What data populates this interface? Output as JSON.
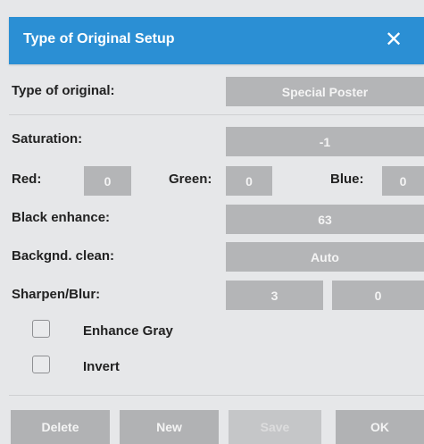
{
  "dialog": {
    "title": "Type of Original Setup",
    "close_glyph": "✕",
    "close_icon": "close-icon"
  },
  "type_of_original": {
    "label": "Type of original:",
    "value": "Special Poster"
  },
  "saturation": {
    "label": "Saturation:",
    "value": "-1"
  },
  "rgb": {
    "red_label": "Red:",
    "red_value": "0",
    "green_label": "Green:",
    "green_value": "0",
    "blue_label": "Blue:",
    "blue_value": "0"
  },
  "black_enhance": {
    "label": "Black enhance:",
    "value": "63"
  },
  "background_clean": {
    "label": "Backgnd. clean:",
    "value": "Auto"
  },
  "sharpen_blur": {
    "label": "Sharpen/Blur:",
    "sharpen_value": "3",
    "blur_value": "0"
  },
  "options": {
    "enhance_gray_label": "Enhance Gray",
    "enhance_gray_checked": false,
    "invert_label": "Invert",
    "invert_checked": false
  },
  "buttons": {
    "delete_label": "Delete",
    "new_label": "New",
    "save_label": "Save",
    "ok_label": "OK"
  },
  "colors": {
    "title_bar": "#2b8fd4",
    "field": "#b4b5b7",
    "background": "#e6e7e9"
  }
}
